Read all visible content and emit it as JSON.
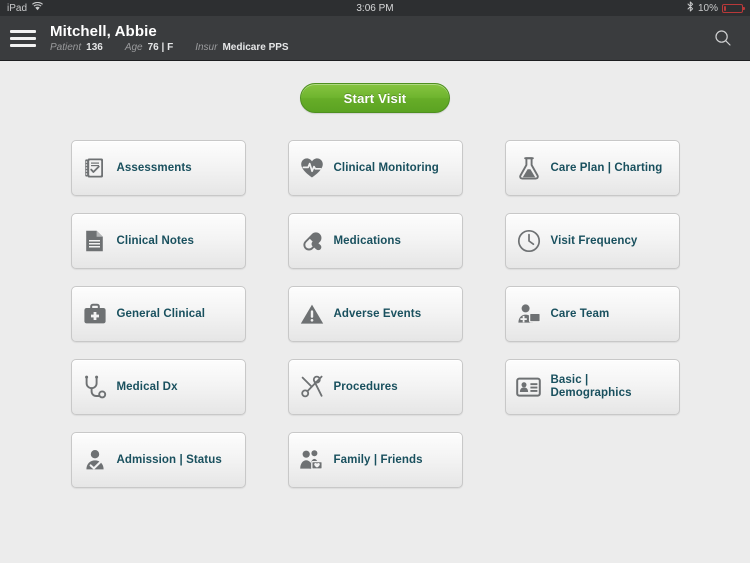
{
  "status_bar": {
    "carrier": "iPad",
    "wifi_icon": "wifi-icon",
    "time": "3:06 PM",
    "bluetooth_icon": "bluetooth-icon",
    "battery_percent": "10%",
    "battery_icon": "battery-icon",
    "battery_color": "#b8393a"
  },
  "header": {
    "menu_icon": "hamburger-menu-icon",
    "patient_name": "Mitchell, Abbie",
    "meta": {
      "patient_label": "Patient",
      "patient_value": "136",
      "age_label": "Age",
      "age_value": "76 | F",
      "insur_label": "Insur",
      "insur_value": "Medicare PPS"
    },
    "search_icon": "search-icon",
    "background_color": "#3a3c3e"
  },
  "main": {
    "start_visit_label": "Start Visit",
    "start_visit_color": "#6fb52f",
    "tile_label_color": "#19505e",
    "background_color": "#ececec",
    "tiles": [
      {
        "label": "Assessments",
        "icon": "clipboard-check-icon"
      },
      {
        "label": "Clinical Monitoring",
        "icon": "heart-pulse-icon"
      },
      {
        "label": "Care Plan | Charting",
        "icon": "flask-icon"
      },
      {
        "label": "Clinical Notes",
        "icon": "document-lines-icon"
      },
      {
        "label": "Medications",
        "icon": "pill-capsule-icon"
      },
      {
        "label": "Visit Frequency",
        "icon": "clock-icon"
      },
      {
        "label": "General Clinical",
        "icon": "medical-bag-icon"
      },
      {
        "label": "Adverse Events",
        "icon": "warning-triangle-icon"
      },
      {
        "label": "Care Team",
        "icon": "people-medical-icon"
      },
      {
        "label": "Medical Dx",
        "icon": "stethoscope-icon"
      },
      {
        "label": "Procedures",
        "icon": "scissors-icon"
      },
      {
        "label": "Basic | Demographics",
        "icon": "id-card-icon"
      },
      {
        "label": "Admission | Status",
        "icon": "person-check-icon"
      },
      {
        "label": "Family | Friends",
        "icon": "family-heart-icon"
      }
    ]
  }
}
